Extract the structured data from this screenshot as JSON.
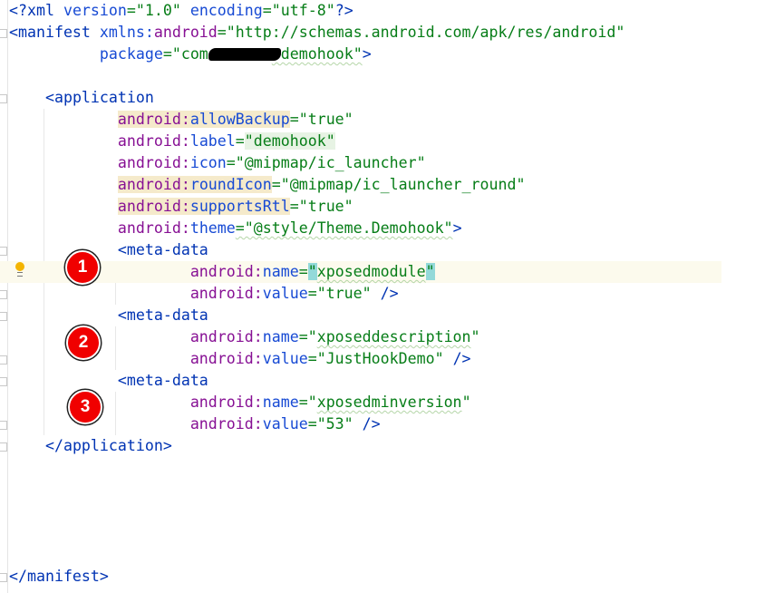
{
  "editor": {
    "lines": [
      [
        {
          "t": "<?",
          "c": "tag"
        },
        {
          "t": "xml ",
          "c": "tag"
        },
        {
          "t": "version",
          "c": "attr"
        },
        {
          "t": "=\"1.0\" ",
          "c": "val"
        },
        {
          "t": "encoding",
          "c": "attr"
        },
        {
          "t": "=\"utf-8\"",
          "c": "val"
        },
        {
          "t": "?>",
          "c": "tag"
        }
      ],
      [
        {
          "t": "<manifest ",
          "c": "tag"
        },
        {
          "t": "xmlns:",
          "c": "attr"
        },
        {
          "t": "android",
          "c": "ns"
        },
        {
          "t": "=\"http://schemas.android.com/apk/res/android\"",
          "c": "val"
        }
      ],
      [
        {
          "t": "          "
        },
        {
          "t": "package",
          "c": "attr"
        },
        {
          "t": "=\"com.",
          "c": "val"
        },
        {
          "t": "",
          "c": "redact"
        },
        {
          "t": ".demohook\"",
          "c": "val wavy"
        },
        {
          "t": ">",
          "c": "tag"
        }
      ],
      [],
      [
        {
          "t": "    "
        },
        {
          "t": "<application",
          "c": "tag"
        }
      ],
      [
        {
          "t": "            "
        },
        {
          "t": "android:",
          "c": "ns hl-attr"
        },
        {
          "t": "allowBackup",
          "c": "attr hl-attr"
        },
        {
          "t": "=\"true\"",
          "c": "val"
        }
      ],
      [
        {
          "t": "            "
        },
        {
          "t": "android:",
          "c": "ns"
        },
        {
          "t": "label",
          "c": "attr"
        },
        {
          "t": "=",
          "c": "val"
        },
        {
          "t": "\"demohook\"",
          "c": "val hl-val"
        }
      ],
      [
        {
          "t": "            "
        },
        {
          "t": "android:",
          "c": "ns"
        },
        {
          "t": "icon",
          "c": "attr"
        },
        {
          "t": "=\"@mipmap/ic_launcher\"",
          "c": "val"
        }
      ],
      [
        {
          "t": "            "
        },
        {
          "t": "android:",
          "c": "ns hl-attr"
        },
        {
          "t": "roundIcon",
          "c": "attr hl-attr"
        },
        {
          "t": "=\"@mipmap/ic_launcher_round\"",
          "c": "val"
        }
      ],
      [
        {
          "t": "            "
        },
        {
          "t": "android:",
          "c": "ns hl-attr"
        },
        {
          "t": "supportsRtl",
          "c": "attr hl-attr"
        },
        {
          "t": "=\"true\"",
          "c": "val"
        }
      ],
      [
        {
          "t": "            "
        },
        {
          "t": "android:",
          "c": "ns"
        },
        {
          "t": "theme",
          "c": "attr"
        },
        {
          "t": "=\"@style/Theme.Demohook\"",
          "c": "val wavy"
        },
        {
          "t": ">",
          "c": "tag"
        }
      ],
      [
        {
          "t": "            "
        },
        {
          "t": "<meta-data",
          "c": "tag"
        }
      ],
      [
        {
          "t": "                    "
        },
        {
          "t": "android:",
          "c": "ns"
        },
        {
          "t": "name",
          "c": "attr"
        },
        {
          "t": "=",
          "c": "val"
        },
        {
          "t": "\"",
          "c": "val hl-quote"
        },
        {
          "t": "xposedmodule",
          "c": "val wavy"
        },
        {
          "t": "\"",
          "c": "val hl-quote"
        }
      ],
      [
        {
          "t": "                    "
        },
        {
          "t": "android:",
          "c": "ns"
        },
        {
          "t": "value",
          "c": "attr"
        },
        {
          "t": "=\"true\" ",
          "c": "val"
        },
        {
          "t": "/>",
          "c": "tag"
        }
      ],
      [
        {
          "t": "            "
        },
        {
          "t": "<meta-data",
          "c": "tag"
        }
      ],
      [
        {
          "t": "                    "
        },
        {
          "t": "android:",
          "c": "ns"
        },
        {
          "t": "name",
          "c": "attr"
        },
        {
          "t": "=\"",
          "c": "val"
        },
        {
          "t": "xposeddescription",
          "c": "val wavy"
        },
        {
          "t": "\"",
          "c": "val"
        }
      ],
      [
        {
          "t": "                    "
        },
        {
          "t": "android:",
          "c": "ns"
        },
        {
          "t": "value",
          "c": "attr"
        },
        {
          "t": "=\"JustHookDemo\" ",
          "c": "val"
        },
        {
          "t": "/>",
          "c": "tag"
        }
      ],
      [
        {
          "t": "            "
        },
        {
          "t": "<meta-data",
          "c": "tag"
        }
      ],
      [
        {
          "t": "                    "
        },
        {
          "t": "android:",
          "c": "ns"
        },
        {
          "t": "name",
          "c": "attr"
        },
        {
          "t": "=\"",
          "c": "val"
        },
        {
          "t": "xposedminversion",
          "c": "val wavy"
        },
        {
          "t": "\"",
          "c": "val"
        }
      ],
      [
        {
          "t": "                    "
        },
        {
          "t": "android:",
          "c": "ns"
        },
        {
          "t": "value",
          "c": "attr"
        },
        {
          "t": "=\"53\" ",
          "c": "val"
        },
        {
          "t": "/>",
          "c": "tag"
        }
      ],
      [
        {
          "t": "    "
        },
        {
          "t": "</application>",
          "c": "tag"
        }
      ],
      [],
      [],
      [],
      [],
      [],
      [
        {
          "t": "</manifest>",
          "c": "tag"
        }
      ]
    ],
    "current_line": 12
  },
  "annotations": [
    "1",
    "2",
    "3"
  ],
  "colors": {
    "badge": "#f00000",
    "tag": "#0033b3",
    "namespace": "#871094",
    "value": "#067d17"
  }
}
